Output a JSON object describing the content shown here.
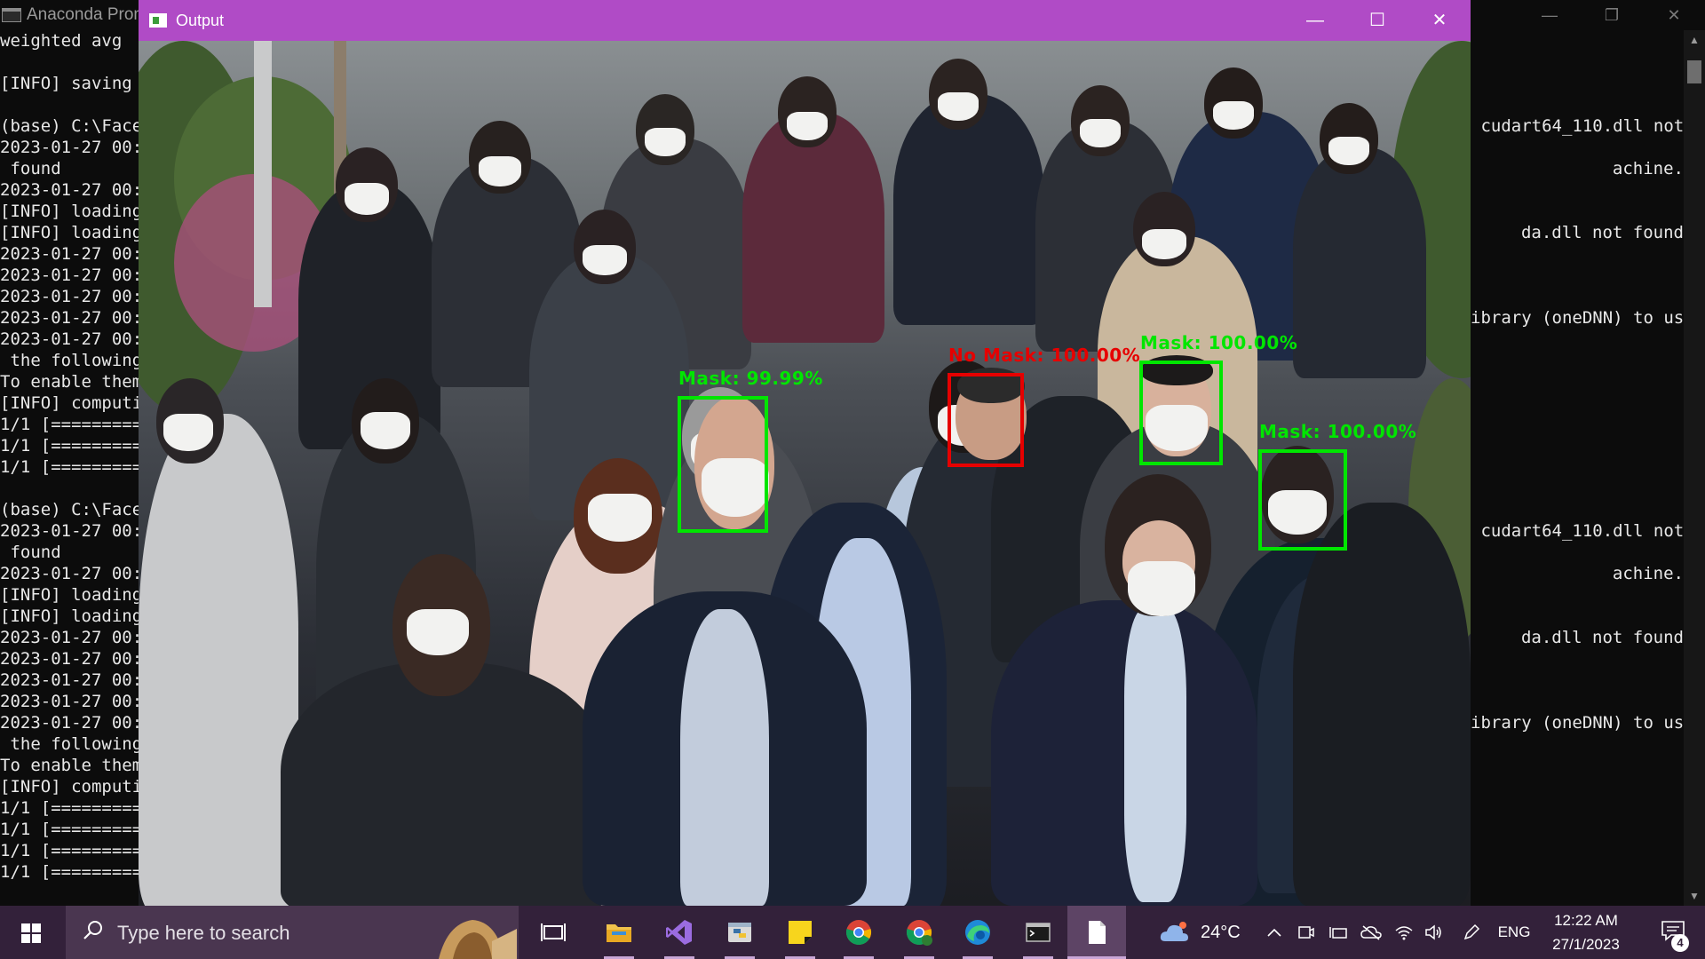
{
  "console": {
    "title": "Anaconda Prom",
    "controls": {
      "minimize": "—",
      "restore": "❐",
      "close": "✕"
    },
    "lines_left": [
      "weighted avg",
      "",
      "[INFO] saving",
      "",
      "(base) C:\\Face",
      "2023-01-27 00:",
      " found",
      "2023-01-27 00:",
      "[INFO] loading",
      "[INFO] loading",
      "2023-01-27 00:",
      "2023-01-27 00:",
      "2023-01-27 00:",
      "2023-01-27 00:",
      "2023-01-27 00:",
      " the following",
      "To enable them",
      "[INFO] computi",
      "1/1 [=========",
      "1/1 [=========",
      "1/1 [=========",
      "",
      "(base) C:\\Face",
      "2023-01-27 00:",
      " found",
      "2023-01-27 00:",
      "[INFO] loading",
      "[INFO] loading",
      "2023-01-27 00:",
      "2023-01-27 00:",
      "2023-01-27 00:",
      "2023-01-27 00:",
      "2023-01-27 00:",
      " the following",
      "To enable them",
      "[INFO] computi",
      "1/1 [=========",
      "1/1 [=========",
      "1/1 [=========",
      "1/1 [========="
    ],
    "lines_right": [
      "",
      "",
      "",
      "",
      " cudart64_110.dll not",
      "",
      "achine.",
      "",
      "",
      "da.dll not found",
      "",
      "",
      "",
      "ibrary (oneDNN) to use",
      "",
      "",
      "",
      "",
      "",
      "",
      "",
      "",
      "",
      " cudart64_110.dll not",
      "",
      "achine.",
      "",
      "",
      "da.dll not found",
      "",
      "",
      "",
      "ibrary (oneDNN) to use"
    ]
  },
  "output_window": {
    "title": "Output",
    "controls": {
      "minimize": "—",
      "maximize": "☐",
      "close": "✕"
    },
    "detections": [
      {
        "label": "Mask: 99.99%",
        "status": "mask",
        "color": "#00e600"
      },
      {
        "label": "No Mask: 100.00%",
        "status": "no-mask",
        "color": "#e60000"
      },
      {
        "label": "Mask: 100.00%",
        "status": "mask",
        "color": "#00e600"
      },
      {
        "label": "Mask: 100.00%",
        "status": "mask",
        "color": "#00e600"
      }
    ]
  },
  "taskbar": {
    "search_placeholder": "Type here to search",
    "apps": [
      {
        "name": "task-view",
        "icon": "task-view-icon"
      },
      {
        "name": "file-explorer",
        "icon": "folder-icon"
      },
      {
        "name": "visual-studio",
        "icon": "visual-studio-icon"
      },
      {
        "name": "python",
        "icon": "python-icon"
      },
      {
        "name": "sticky-notes",
        "icon": "sticky-notes-icon"
      },
      {
        "name": "chrome",
        "icon": "chrome-icon"
      },
      {
        "name": "chrome-profile",
        "icon": "chrome-icon"
      },
      {
        "name": "edge",
        "icon": "edge-icon"
      },
      {
        "name": "terminal",
        "icon": "terminal-icon"
      },
      {
        "name": "document",
        "icon": "document-icon"
      }
    ],
    "weather": {
      "temperature": "24°C",
      "icon": "weather-cloud-icon"
    },
    "tray": {
      "language": "ENG"
    },
    "clock": {
      "time": "12:22 AM",
      "date": "27/1/2023"
    },
    "notifications": {
      "count": "4"
    },
    "colors": {
      "taskbar": "#33213a",
      "output_titlebar": "#b04bc6"
    }
  }
}
